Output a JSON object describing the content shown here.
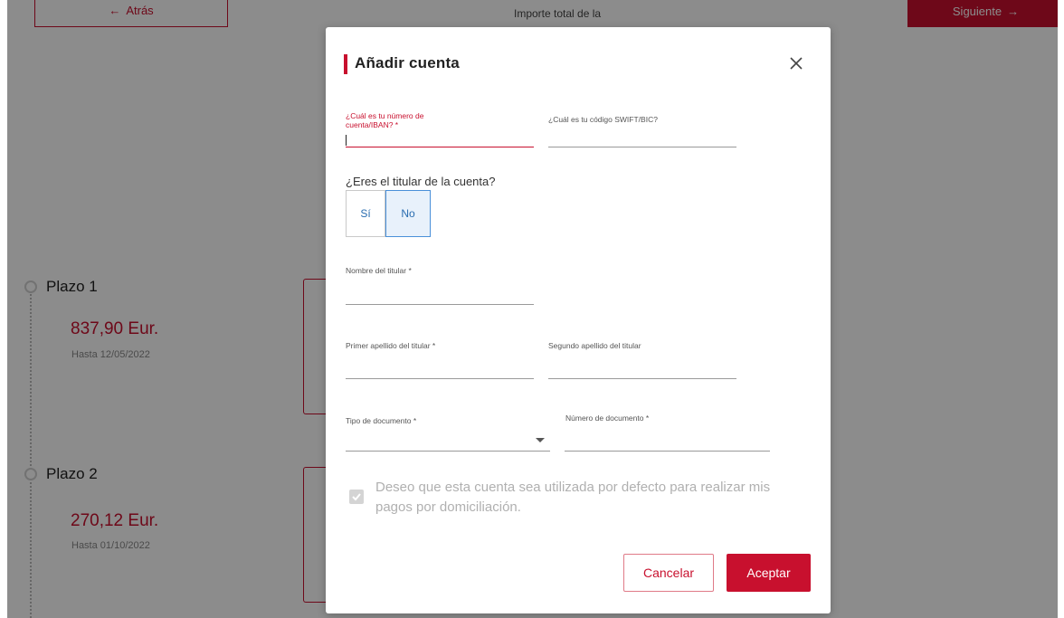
{
  "background": {
    "back_label": "Atrás",
    "next_label": "Siguiente",
    "total_label": "Importe total de la",
    "plazos": [
      {
        "title": "Plazo 1",
        "amount": "837,90 Eur.",
        "date": "Hasta 12/05/2022"
      },
      {
        "title": "Plazo 2",
        "amount": "270,12 Eur.",
        "date": "Hasta 01/10/2022"
      }
    ]
  },
  "modal": {
    "title": "Añadir cuenta",
    "close_icon": "close-icon",
    "fields": {
      "iban_label": "¿Cuál es tu número de cuenta/IBAN? *",
      "iban_value": "",
      "swift_label": "¿Cuál es tu código SWIFT/BIC?",
      "swift_value": "",
      "holder_question": "¿Eres el titular de la cuenta?",
      "option_yes": "Sí",
      "option_no": "No",
      "selected_option": "No",
      "holder_name_label": "Nombre del titular *",
      "holder_name_value": "",
      "first_surname_label": "Primer apellido del titular *",
      "first_surname_value": "",
      "second_surname_label": "Segundo apellido del titular",
      "second_surname_value": "",
      "doc_type_label": "Tipo de documento *",
      "doc_type_value": "",
      "doc_number_label": "Número de documento *",
      "doc_number_value": ""
    },
    "default_account_checkbox": {
      "checked": true,
      "text": "Deseo que esta cuenta sea utilizada por defecto para realizar mis pagos por domiciliación."
    },
    "cancel_label": "Cancelar",
    "accept_label": "Aceptar"
  },
  "colors": {
    "brand_red": "#c8102e",
    "selected_blue": "#4a90d9",
    "overlay": "rgba(0,0,0,0.45)"
  }
}
